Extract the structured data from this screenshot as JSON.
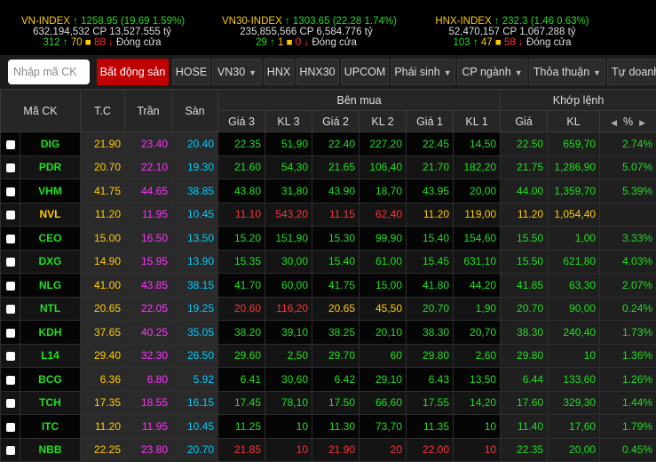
{
  "indices": [
    {
      "name": "VN-INDEX",
      "arrow": "↑",
      "value": "1258.95",
      "change": "(19.69  1.59%)",
      "volume": "632,194,532",
      "value_text": "CP 13,527.555 tỷ",
      "up": "312",
      "same": "70",
      "down": "88",
      "status": "Đóng cửa"
    },
    {
      "name": "VN30-INDEX",
      "arrow": "↑",
      "value": "1303.65",
      "change": "(22.28  1.74%)",
      "volume": "235,855,566",
      "value_text": "CP 6,584.776 tỷ",
      "up": "29",
      "same": "1",
      "down": "0",
      "status": "Đóng cửa"
    },
    {
      "name": "HNX-INDEX",
      "arrow": "↑",
      "value": "232.3",
      "change": "(1.46  0.63%)",
      "volume": "52,470,157",
      "value_text": "CP 1,067.288 tỷ",
      "up": "103",
      "same": "47",
      "down": "58",
      "status": "Đóng cửa"
    }
  ],
  "search": {
    "placeholder": "Nhập mã CK"
  },
  "tabs": [
    {
      "label": "Bất động sản",
      "active": true,
      "chevron": false
    },
    {
      "label": "HOSE",
      "chevron": false
    },
    {
      "label": "VN30",
      "chevron": true
    },
    {
      "label": "HNX",
      "chevron": false
    },
    {
      "label": "HNX30",
      "chevron": false
    },
    {
      "label": "UPCOM",
      "chevron": false
    },
    {
      "label": "Phái sinh",
      "chevron": true
    },
    {
      "label": "CP ngành",
      "chevron": true
    },
    {
      "label": "Thỏa thuận",
      "chevron": true
    },
    {
      "label": "Tự doanh",
      "chevron": false
    }
  ],
  "headers": {
    "symbol": "Mã CK",
    "ref": "T.C",
    "ceil": "Trần",
    "floor": "Sàn",
    "buy_group": "Bên mua",
    "match_group": "Khớp lệnh",
    "p3": "Giá 3",
    "v3": "KL 3",
    "p2": "Giá 2",
    "v2": "KL 2",
    "p1": "Giá 1",
    "v1": "KL 1",
    "mp": "Giá",
    "mv": "KL",
    "pct": "%"
  },
  "rows": [
    {
      "sym": "DIG",
      "ref": "21.90",
      "ceil": "23.40",
      "floor": "20.40",
      "p3": "22.35",
      "v3": "51,90",
      "p2": "22.40",
      "v2": "227,20",
      "p1": "22.45",
      "v1": "14,50",
      "mp": "22.50",
      "mv": "659,70",
      "pct": "2.74%",
      "color": "g",
      "c3": "g",
      "c2": "g",
      "c1": "g",
      "cm": "g"
    },
    {
      "sym": "PDR",
      "ref": "20.70",
      "ceil": "22.10",
      "floor": "19.30",
      "p3": "21.60",
      "v3": "54,30",
      "p2": "21.65",
      "v2": "106,40",
      "p1": "21.70",
      "v1": "182,20",
      "mp": "21.75",
      "mv": "1,286,90",
      "pct": "5.07%",
      "color": "g",
      "c3": "g",
      "c2": "g",
      "c1": "g",
      "cm": "g"
    },
    {
      "sym": "VHM",
      "ref": "41.75",
      "ceil": "44.65",
      "floor": "38.85",
      "p3": "43.80",
      "v3": "31,80",
      "p2": "43.90",
      "v2": "18,70",
      "p1": "43.95",
      "v1": "20,00",
      "mp": "44.00",
      "mv": "1,359,70",
      "pct": "5.39%",
      "color": "g",
      "c3": "g",
      "c2": "g",
      "c1": "g",
      "cm": "g"
    },
    {
      "sym": "NVL",
      "ref": "11.20",
      "ceil": "11.95",
      "floor": "10.45",
      "p3": "11.10",
      "v3": "543,20",
      "p2": "11.15",
      "v2": "62,40",
      "p1": "11.20",
      "v1": "119,00",
      "mp": "11.20",
      "mv": "1,054,40",
      "pct": "",
      "color": "y",
      "c3": "r",
      "c2": "r",
      "c1": "y",
      "cm": "y"
    },
    {
      "sym": "CEO",
      "ref": "15.00",
      "ceil": "16.50",
      "floor": "13.50",
      "p3": "15.20",
      "v3": "151,90",
      "p2": "15.30",
      "v2": "99,90",
      "p1": "15.40",
      "v1": "154,60",
      "mp": "15.50",
      "mv": "1,00",
      "pct": "3.33%",
      "color": "g",
      "c3": "g",
      "c2": "g",
      "c1": "g",
      "cm": "g"
    },
    {
      "sym": "DXG",
      "ref": "14.90",
      "ceil": "15.95",
      "floor": "13.90",
      "p3": "15.35",
      "v3": "30,00",
      "p2": "15.40",
      "v2": "61,00",
      "p1": "15.45",
      "v1": "631,10",
      "mp": "15.50",
      "mv": "621,80",
      "pct": "4.03%",
      "color": "g",
      "c3": "g",
      "c2": "g",
      "c1": "g",
      "cm": "g"
    },
    {
      "sym": "NLG",
      "ref": "41.00",
      "ceil": "43.85",
      "floor": "38.15",
      "p3": "41.70",
      "v3": "60,00",
      "p2": "41.75",
      "v2": "15,00",
      "p1": "41.80",
      "v1": "44,20",
      "mp": "41.85",
      "mv": "63,30",
      "pct": "2.07%",
      "color": "g",
      "c3": "g",
      "c2": "g",
      "c1": "g",
      "cm": "g"
    },
    {
      "sym": "NTL",
      "ref": "20.65",
      "ceil": "22.05",
      "floor": "19.25",
      "p3": "20.60",
      "v3": "116,20",
      "p2": "20.65",
      "v2": "45,50",
      "p1": "20.70",
      "v1": "1,90",
      "mp": "20.70",
      "mv": "90,00",
      "pct": "0.24%",
      "color": "g",
      "c3": "r",
      "c2": "y",
      "c1": "g",
      "cm": "g"
    },
    {
      "sym": "KDH",
      "ref": "37.65",
      "ceil": "40.25",
      "floor": "35.05",
      "p3": "38.20",
      "v3": "39,10",
      "p2": "38.25",
      "v2": "20,10",
      "p1": "38.30",
      "v1": "20,70",
      "mp": "38.30",
      "mv": "240,40",
      "pct": "1.73%",
      "color": "g",
      "c3": "g",
      "c2": "g",
      "c1": "g",
      "cm": "g"
    },
    {
      "sym": "L14",
      "ref": "29.40",
      "ceil": "32.30",
      "floor": "26.50",
      "p3": "29.60",
      "v3": "2,50",
      "p2": "29.70",
      "v2": "60",
      "p1": "29.80",
      "v1": "2,60",
      "mp": "29.80",
      "mv": "10",
      "pct": "1.36%",
      "color": "g",
      "c3": "g",
      "c2": "g",
      "c1": "g",
      "cm": "g"
    },
    {
      "sym": "BCG",
      "ref": "6.36",
      "ceil": "6.80",
      "floor": "5.92",
      "p3": "6.41",
      "v3": "30,60",
      "p2": "6.42",
      "v2": "29,10",
      "p1": "6.43",
      "v1": "13,50",
      "mp": "6.44",
      "mv": "133,60",
      "pct": "1.26%",
      "color": "g",
      "c3": "g",
      "c2": "g",
      "c1": "g",
      "cm": "g"
    },
    {
      "sym": "TCH",
      "ref": "17.35",
      "ceil": "18.55",
      "floor": "16.15",
      "p3": "17.45",
      "v3": "78,10",
      "p2": "17.50",
      "v2": "66,60",
      "p1": "17.55",
      "v1": "14,20",
      "mp": "17.60",
      "mv": "329,30",
      "pct": "1.44%",
      "color": "g",
      "c3": "g",
      "c2": "g",
      "c1": "g",
      "cm": "g"
    },
    {
      "sym": "ITC",
      "ref": "11.20",
      "ceil": "11.95",
      "floor": "10.45",
      "p3": "11.25",
      "v3": "10",
      "p2": "11.30",
      "v2": "73,70",
      "p1": "11.35",
      "v1": "10",
      "mp": "11.40",
      "mv": "17,60",
      "pct": "1.79%",
      "color": "g",
      "c3": "g",
      "c2": "g",
      "c1": "g",
      "cm": "g"
    },
    {
      "sym": "NBB",
      "ref": "22.25",
      "ceil": "23.80",
      "floor": "20.70",
      "p3": "21.85",
      "v3": "10",
      "p2": "21.90",
      "v2": "20",
      "p1": "22.00",
      "v1": "10",
      "mp": "22.35",
      "mv": "20,00",
      "pct": "0.45%",
      "color": "g",
      "c3": "r",
      "c2": "r",
      "c1": "r",
      "cm": "g"
    }
  ]
}
